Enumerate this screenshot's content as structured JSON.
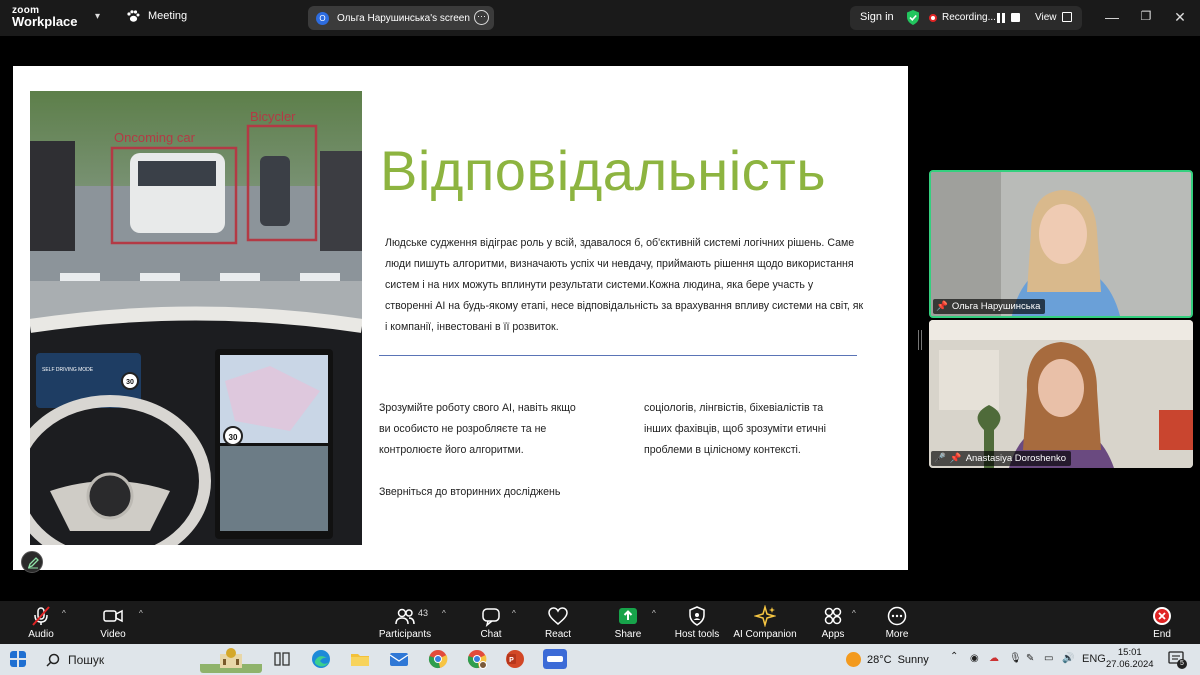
{
  "titlebar": {
    "brand_top": "zoom",
    "brand_bottom": "Workplace",
    "meeting_label": "Meeting",
    "screen_owner_initial": "O",
    "screen_label": "Ольга Нарушинська's screen",
    "sign_in": "Sign in",
    "recording_label": "Recording...",
    "view_label": "View"
  },
  "slide": {
    "title": "Відповідальність",
    "photo_label_1": "Oncoming car",
    "photo_label_2": "Bicycler",
    "photo_speed_1": "30",
    "photo_speed_2": "30",
    "photo_dash_text": "SELF DRIVING MODE",
    "paragraph_lines": [
      "Людське судження відіграє роль у всій, здавалося б, об'єктивній системі логічних рішень. Саме",
      "люди пишуть алгоритми, визначають успіх чи невдачу, приймають рішення щодо використання",
      "систем і на них можуть вплинути результати системи.Кожна людина, яка бере участь у",
      "створенні AI на будь-якому етапі, несе відповідальність за врахування впливу системи на світ, як",
      "і компанії, інвестовані в її розвиток."
    ],
    "col1_lines": [
      "Зрозумійте роботу свого AI, навіть якщо",
      "ви особисто не розробляєте та не",
      "контролюєте його алгоритми."
    ],
    "col1_extra": "Зверніться до вторинних досліджень",
    "col2_lines": [
      "соціологів, лінгвістів, біхевіалістів та",
      "інших фахівців, щоб зрозуміти етичні",
      "проблеми в цілісному контексті."
    ]
  },
  "participants": [
    {
      "name": "Ольга Нарушинська",
      "active_speaker": true
    },
    {
      "name": "Anastasiya Doroshenko",
      "muted": true
    }
  ],
  "toolbar": {
    "audio": "Audio",
    "video": "Video",
    "participants": "Participants",
    "participants_count": "43",
    "chat": "Chat",
    "react": "React",
    "share": "Share",
    "host_tools": "Host tools",
    "ai_companion": "AI Companion",
    "apps": "Apps",
    "more": "More",
    "end": "End"
  },
  "taskbar": {
    "search_placeholder": "Пошук",
    "weather": "28°C",
    "weather_desc": "Sunny",
    "lang": "ENG",
    "time": "15:01",
    "date": "27.06.2024",
    "notifications": "5"
  },
  "colors": {
    "accent_green": "#8db440",
    "speaker_border": "#35d07f",
    "share_green": "#17a34a",
    "end_red": "#e02424"
  }
}
